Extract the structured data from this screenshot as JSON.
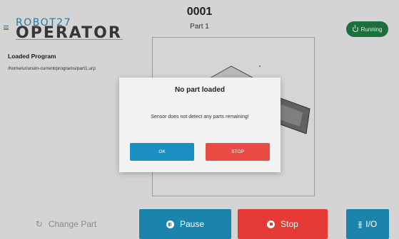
{
  "header": {
    "logo_top": "ROBOT27",
    "logo_bottom": "OPERATOR",
    "part_number": "0001",
    "part_name": "Part 1",
    "status_label": "Running",
    "status_color": "#1f7a43"
  },
  "program": {
    "label": "Loaded Program",
    "path": "/home/ur/ursim-current/programs/part1.urp"
  },
  "dialog": {
    "title": "No part loaded",
    "message": "Sensor does not detect any parts remaining!",
    "ok_label": "OK",
    "stop_label": "STOP",
    "ok_color": "#1a90c2",
    "stop_color": "#ea4c45"
  },
  "footer": {
    "change_part_label": "Change Part",
    "pause_label": "Pause",
    "stop_label": "Stop",
    "io_label": "I/O",
    "icons": {
      "change_part": "refresh-icon",
      "pause": "pause-icon",
      "stop": "stop-icon",
      "io": "io-sliders-icon"
    }
  }
}
